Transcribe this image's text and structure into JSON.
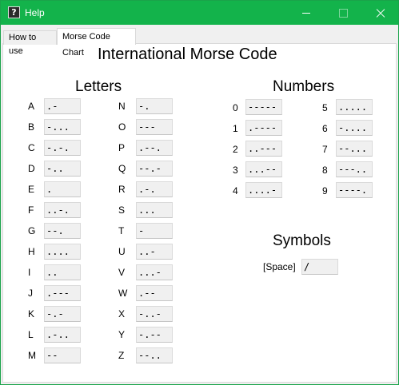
{
  "window": {
    "title": "Help",
    "app_icon_glyph": "?"
  },
  "tabs": [
    {
      "label": "How to use",
      "active": false
    },
    {
      "label": "Morse Code Chart",
      "active": true
    }
  ],
  "chart": {
    "title": "International Morse Code",
    "letters_heading": "Letters",
    "numbers_heading": "Numbers",
    "symbols_heading": "Symbols"
  },
  "letters": [
    {
      "char": "A",
      "code": ".-"
    },
    {
      "char": "B",
      "code": "-..."
    },
    {
      "char": "C",
      "code": "-.-."
    },
    {
      "char": "D",
      "code": "-.."
    },
    {
      "char": "E",
      "code": "."
    },
    {
      "char": "F",
      "code": "..-."
    },
    {
      "char": "G",
      "code": "--."
    },
    {
      "char": "H",
      "code": "...."
    },
    {
      "char": "I",
      "code": ".."
    },
    {
      "char": "J",
      "code": ".---"
    },
    {
      "char": "K",
      "code": "-.-"
    },
    {
      "char": "L",
      "code": ".-.."
    },
    {
      "char": "M",
      "code": "--"
    },
    {
      "char": "N",
      "code": "-."
    },
    {
      "char": "O",
      "code": "---"
    },
    {
      "char": "P",
      "code": ".--."
    },
    {
      "char": "Q",
      "code": "--.-"
    },
    {
      "char": "R",
      "code": ".-."
    },
    {
      "char": "S",
      "code": "..."
    },
    {
      "char": "T",
      "code": "-"
    },
    {
      "char": "U",
      "code": "..-"
    },
    {
      "char": "V",
      "code": "...-"
    },
    {
      "char": "W",
      "code": ".--"
    },
    {
      "char": "X",
      "code": "-..-"
    },
    {
      "char": "Y",
      "code": "-.--"
    },
    {
      "char": "Z",
      "code": "--.."
    }
  ],
  "numbers": [
    {
      "char": "0",
      "code": "-----"
    },
    {
      "char": "1",
      "code": ".----"
    },
    {
      "char": "2",
      "code": "..---"
    },
    {
      "char": "3",
      "code": "...--"
    },
    {
      "char": "4",
      "code": "....-"
    },
    {
      "char": "5",
      "code": "....."
    },
    {
      "char": "6",
      "code": "-...."
    },
    {
      "char": "7",
      "code": "--..."
    },
    {
      "char": "8",
      "code": "---.."
    },
    {
      "char": "9",
      "code": "----."
    }
  ],
  "symbols": [
    {
      "char": "[Space]",
      "code": "/"
    }
  ]
}
